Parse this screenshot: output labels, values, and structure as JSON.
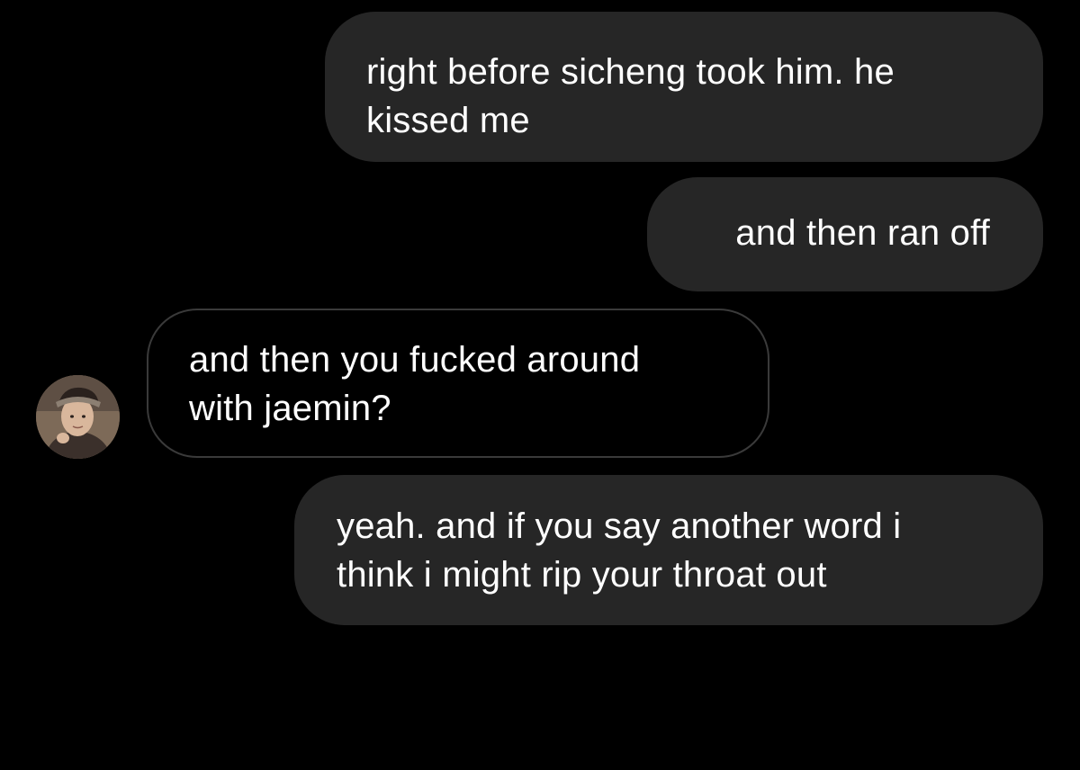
{
  "conversation": {
    "messages": [
      {
        "sender": "me",
        "text": "right before sicheng took him. he\nkissed me"
      },
      {
        "sender": "me",
        "text": "and then ran off"
      },
      {
        "sender": "other",
        "text": "and then you fucked around\nwith jaemin?"
      },
      {
        "sender": "me",
        "text": "yeah. and if you say another word i\nthink i might rip your throat out"
      }
    ]
  },
  "colors": {
    "background": "#000000",
    "outgoing_bubble": "#262626",
    "incoming_border": "#3a3a3a",
    "text": "#ffffff"
  },
  "icons": {
    "avatar": "contact-avatar-photo"
  }
}
